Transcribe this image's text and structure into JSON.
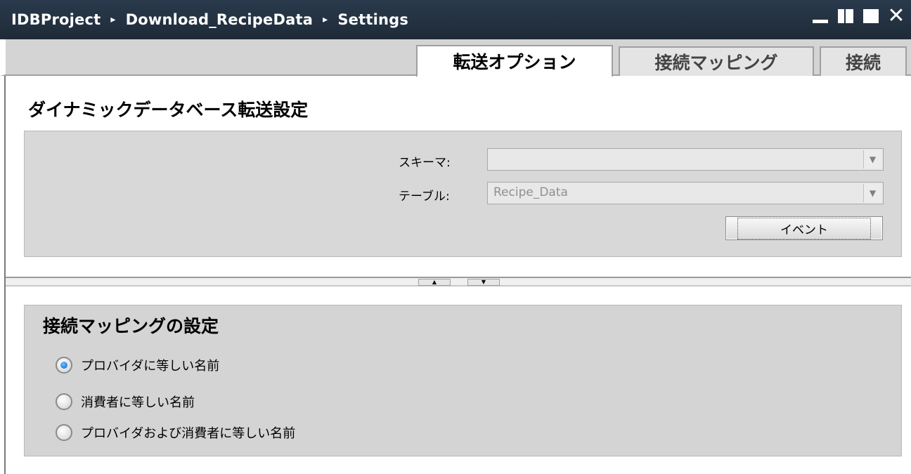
{
  "titlebar": {
    "breadcrumb": [
      "IDBProject",
      "Download_RecipeData",
      "Settings"
    ],
    "separator": "▸"
  },
  "tabs": [
    {
      "label": "転送オプション",
      "active": true
    },
    {
      "label": "接続マッピング",
      "active": false
    },
    {
      "label": "接続",
      "active": false
    }
  ],
  "transfer": {
    "title": "ダイナミックデータベース転送設定",
    "schema_label": "スキーマ:",
    "schema_value": "",
    "table_label": "テーブル:",
    "table_value": "Recipe_Data",
    "event_button": "イベント"
  },
  "splitter": {
    "up": "▲",
    "down": "▼"
  },
  "mapping": {
    "title": "接続マッピングの設定",
    "options": [
      {
        "label": "プロバイダに等しい名前",
        "checked": true
      },
      {
        "label": "消費者に等しい名前",
        "checked": false
      },
      {
        "label": "プロバイダおよび消費者に等しい名前",
        "checked": false
      }
    ]
  },
  "colors": {
    "titlebar_bg": "#2a3a4c",
    "panel_bg": "#d8d8d8",
    "radio_accent": "#0a64c8"
  }
}
